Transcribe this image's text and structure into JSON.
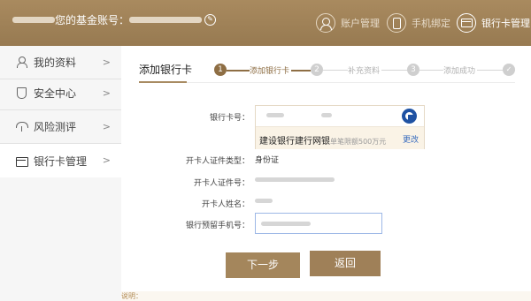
{
  "header": {
    "account_label": "您的基金账号：",
    "nav": [
      {
        "label": "账户管理",
        "icon": "user-icon"
      },
      {
        "label": "手机绑定",
        "icon": "phone-icon"
      },
      {
        "label": "银行卡管理",
        "icon": "bank-card-icon",
        "active": true
      }
    ]
  },
  "sidebar": {
    "items": [
      {
        "label": "我的资料",
        "icon": "person-icon"
      },
      {
        "label": "安全中心",
        "icon": "shield-icon"
      },
      {
        "label": "风险测评",
        "icon": "umbrella-icon"
      },
      {
        "label": "银行卡管理",
        "icon": "bank-card-icon",
        "active": true
      }
    ]
  },
  "main": {
    "tab_title": "添加银行卡",
    "steps": [
      {
        "num": "1",
        "label": "添加银行卡",
        "state": "done"
      },
      {
        "num": "2",
        "label": "补充资料",
        "state": "todo"
      },
      {
        "num": "3",
        "label": "添加成功",
        "state": "todo"
      },
      {
        "num": "✓",
        "label": "",
        "state": "todo"
      }
    ],
    "form": {
      "card_label": "银行卡号：",
      "bank_name": "建设银行建行网银",
      "bank_limit": "单笔限额500万元",
      "change_link": "更改",
      "id_type_label": "开卡人证件类型：",
      "id_type_value": "身份证",
      "id_no_label": "开卡人证件号：",
      "name_label": "开卡人姓名：",
      "phone_label": "银行预留手机号："
    },
    "buttons": {
      "next": "下一步",
      "back": "返回"
    },
    "note": "说明："
  },
  "colors": {
    "brand": "#a98a5f",
    "step_active": "#8e6e44",
    "link": "#3a6dbf"
  }
}
